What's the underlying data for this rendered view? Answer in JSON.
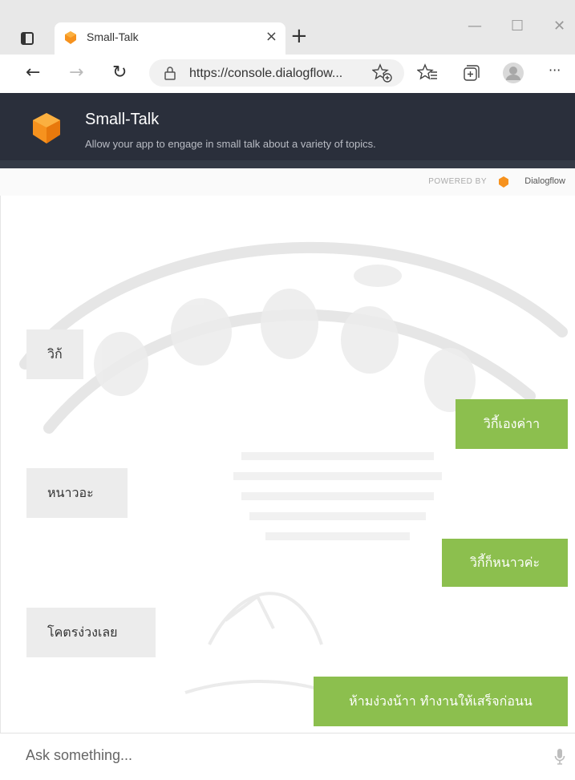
{
  "browser": {
    "tab": {
      "title": "Small-Talk",
      "close": "×"
    },
    "new_tab": "+",
    "window_controls": {
      "minimize": "—",
      "maximize": "☐",
      "close": "✕"
    },
    "nav": {
      "back": "←",
      "forward": "→",
      "reload": "↻",
      "more": "···"
    },
    "url": "https://console.dialogflow...",
    "icons": [
      "tab-actions-icon",
      "favicon-icon",
      "lock-icon",
      "favorite-add-icon",
      "favorites-icon",
      "collections-icon",
      "profile-icon",
      "more-icon"
    ]
  },
  "agent": {
    "name": "Small-Talk",
    "description": "Allow your app to engage in small talk about a variety of topics.",
    "powered_by": "POWERED BY",
    "provider": "Dialogflow",
    "accent": "#f6921e",
    "header_bg": "#2a2f3b",
    "bot_bubble_color": "#8cbf4e"
  },
  "messages": [
    {
      "from": "user",
      "text": "วิก้"
    },
    {
      "from": "bot",
      "text": "วิกี้เองค่าา"
    },
    {
      "from": "user",
      "text": "หนาวอะ"
    },
    {
      "from": "bot",
      "text": "วิกี้ก็หนาวค่ะ"
    },
    {
      "from": "user",
      "text": "โคตรง่วงเลย"
    },
    {
      "from": "bot",
      "text": "ห้ามง่วงน้าา ทำงานให้เสร็จก่อนน"
    }
  ],
  "input": {
    "placeholder": "Ask something..."
  }
}
